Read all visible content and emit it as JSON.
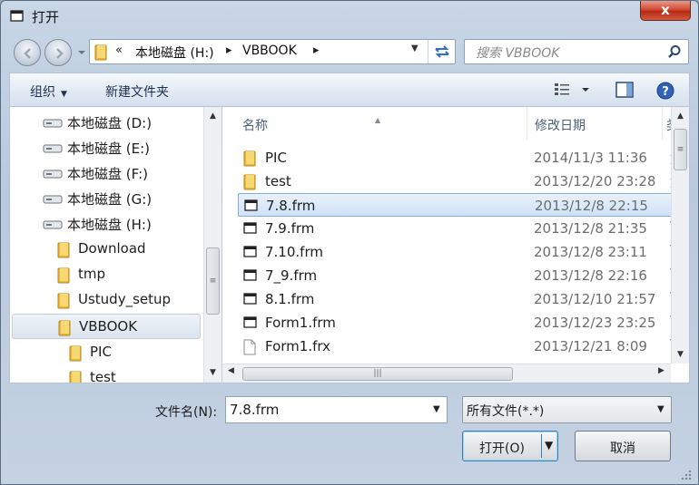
{
  "window": {
    "title": "打开",
    "close_label": "x"
  },
  "address": {
    "overflow": "«",
    "segments": [
      "本地磁盘 (H:)",
      "VBBOOK"
    ],
    "separator": "▸"
  },
  "search": {
    "placeholder": "搜索 VBBOOK"
  },
  "toolbar": {
    "organize": "组织",
    "new_folder": "新建文件夹"
  },
  "nav_pane": {
    "items": [
      {
        "label": "本地磁盘 (D:)",
        "icon": "drive-icon"
      },
      {
        "label": "本地磁盘 (E:)",
        "icon": "drive-icon"
      },
      {
        "label": "本地磁盘 (F:)",
        "icon": "drive-icon"
      },
      {
        "label": "本地磁盘 (G:)",
        "icon": "drive-icon"
      },
      {
        "label": "本地磁盘 (H:)",
        "icon": "drive-icon"
      },
      {
        "label": "Download",
        "icon": "folder-icon"
      },
      {
        "label": "tmp",
        "icon": "folder-icon"
      },
      {
        "label": "Ustudy_setup",
        "icon": "folder-icon"
      },
      {
        "label": "VBBOOK",
        "icon": "folder-icon",
        "selected": true
      },
      {
        "label": "PIC",
        "icon": "folder-icon"
      },
      {
        "label": "test",
        "icon": "folder-icon"
      }
    ]
  },
  "file_list": {
    "columns": [
      "名称",
      "修改日期",
      "类"
    ],
    "rows": [
      {
        "name": "PIC",
        "date": "2014/11/3 11:36",
        "extra": "文",
        "icon": "folder-icon"
      },
      {
        "name": "test",
        "date": "2013/12/20 23:28",
        "extra": "文",
        "icon": "folder-icon"
      },
      {
        "name": "7.8.frm",
        "date": "2013/12/8 22:15",
        "extra": "V",
        "icon": "vb-form-icon",
        "selected": true
      },
      {
        "name": "7.9.frm",
        "date": "2013/12/8 21:35",
        "extra": "V",
        "icon": "vb-form-icon"
      },
      {
        "name": "7.10.frm",
        "date": "2013/12/8 23:11",
        "extra": "V",
        "icon": "vb-form-icon"
      },
      {
        "name": "7_9.frm",
        "date": "2013/12/8 22:16",
        "extra": "V",
        "icon": "vb-form-icon"
      },
      {
        "name": "8.1.frm",
        "date": "2013/12/10 21:57",
        "extra": "V",
        "icon": "vb-form-icon"
      },
      {
        "name": "Form1.frm",
        "date": "2013/12/23 23:25",
        "extra": "V",
        "icon": "vb-form-icon"
      },
      {
        "name": "Form1.frx",
        "date": "2013/12/21 8:09",
        "extra": "V",
        "icon": "file-icon"
      }
    ]
  },
  "bottom": {
    "filename_label": "文件名(N):",
    "filename_value": "7.8.frm",
    "filetype_value": "所有文件(*.*)",
    "open_label": "打开(O)",
    "cancel_label": "取消"
  }
}
